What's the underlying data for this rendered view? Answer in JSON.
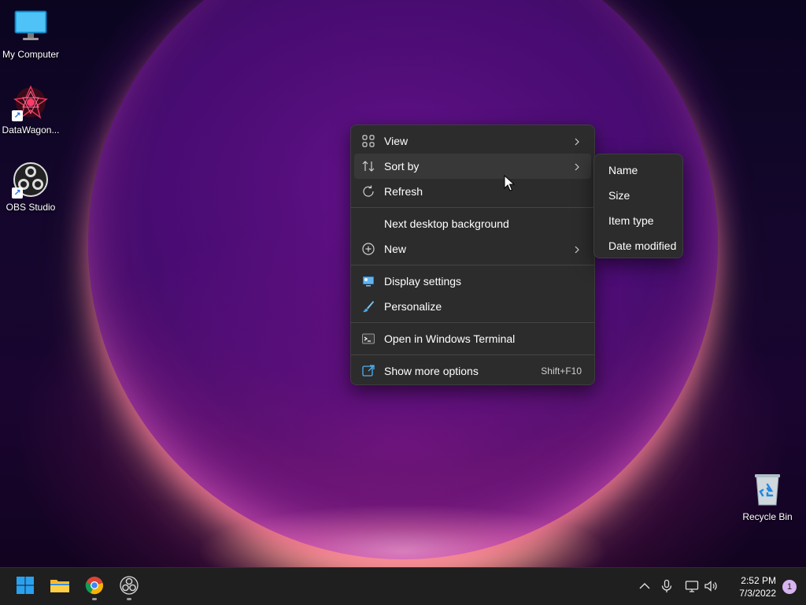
{
  "desktop": {
    "icons": [
      {
        "label": "My Computer",
        "icon": "monitor-icon",
        "shortcut": false
      },
      {
        "label": "DataWagon...",
        "icon": "datawagon-app-icon",
        "shortcut": true
      },
      {
        "label": "OBS Studio",
        "icon": "obs-studio-icon",
        "shortcut": true
      },
      {
        "label": "Recycle Bin",
        "icon": "recycle-bin-icon",
        "shortcut": false
      }
    ]
  },
  "context_menu": {
    "items": [
      {
        "label": "View",
        "icon": "view-grid-icon",
        "has_submenu": true
      },
      {
        "label": "Sort by",
        "icon": "sort-icon",
        "has_submenu": true,
        "active": true
      },
      {
        "label": "Refresh",
        "icon": "refresh-icon",
        "has_submenu": false
      },
      {
        "label": "Next desktop background",
        "icon": "",
        "has_submenu": false
      },
      {
        "label": "New",
        "icon": "new-plus-icon",
        "has_submenu": true
      },
      {
        "label": "Display settings",
        "icon": "display-settings-icon",
        "has_submenu": false
      },
      {
        "label": "Personalize",
        "icon": "personalize-brush-icon",
        "has_submenu": false
      },
      {
        "label": "Open in Windows Terminal",
        "icon": "terminal-icon",
        "has_submenu": false
      },
      {
        "label": "Show more options",
        "icon": "show-more-options-icon",
        "shortcut": "Shift+F10"
      }
    ]
  },
  "sort_submenu": {
    "items": [
      "Name",
      "Size",
      "Item type",
      "Date modified"
    ]
  },
  "taskbar": {
    "apps": [
      {
        "name": "start-button",
        "icon": "windows-start-icon"
      },
      {
        "name": "file-explorer",
        "icon": "file-explorer-icon"
      },
      {
        "name": "chrome",
        "icon": "chrome-icon",
        "running": true
      },
      {
        "name": "obs-studio",
        "icon": "obs-studio-icon",
        "running": true
      }
    ],
    "tray": {
      "icons": [
        "chevron-up-icon",
        "microphone-icon",
        "network-icon",
        "volume-icon"
      ],
      "time": "2:52 PM",
      "date": "7/3/2022",
      "notification_count": "1"
    }
  },
  "colors": {
    "menu_bg": "#2c2c2c",
    "menu_active": "#383838",
    "taskbar_bg": "#1f1f1f",
    "accent_blue": "#0078d4"
  }
}
